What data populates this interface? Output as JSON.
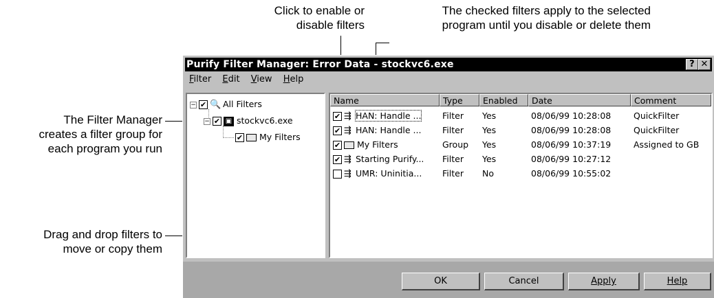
{
  "callouts": {
    "enable_line1": "Click to enable or",
    "enable_line2": "disable filters",
    "checked_line1": "The checked filters apply to the selected",
    "checked_line2": "program until you disable or delete them",
    "manager_line1": "The Filter Manager",
    "manager_line2": "creates a filter group for",
    "manager_line3": "each program you run",
    "drag_line1": "Drag and drop filters to",
    "drag_line2": "move or copy them"
  },
  "window": {
    "title": "Purify Filter Manager: Error Data - stockvc6.exe",
    "help_button": "?",
    "close_button": "✕"
  },
  "menu": [
    {
      "key": "F",
      "rest": "ilter"
    },
    {
      "key": "E",
      "rest": "dit"
    },
    {
      "key": "V",
      "rest": "iew"
    },
    {
      "key": "H",
      "rest": "elp"
    }
  ],
  "tree": {
    "root": "All Filters",
    "program": "stockvc6.exe",
    "group": "My Filters",
    "expander": "−"
  },
  "table": {
    "headers": [
      "Name",
      "Type",
      "Enabled",
      "Date",
      "Comment"
    ],
    "rows": [
      {
        "checked": "✔",
        "name": "HAN: Handle ...",
        "type": "Filter",
        "enabled": "Yes",
        "date": "08/06/99 10:28:08",
        "comment": "QuickFilter"
      },
      {
        "checked": "✔",
        "name": "HAN: Handle ...",
        "type": "Filter",
        "enabled": "Yes",
        "date": "08/06/99 10:28:08",
        "comment": "QuickFilter"
      },
      {
        "checked": "✔",
        "name": "My Filters",
        "type": "Group",
        "enabled": "Yes",
        "date": "08/06/99 10:37:19",
        "comment": "Assigned to GB"
      },
      {
        "checked": "✔",
        "name": "Starting Purify...",
        "type": "Filter",
        "enabled": "Yes",
        "date": "08/06/99 10:27:12",
        "comment": ""
      },
      {
        "checked": "",
        "name": "UMR: Uninitia...",
        "type": "Filter",
        "enabled": "No",
        "date": "08/06/99 10:55:02",
        "comment": ""
      }
    ]
  },
  "buttons": {
    "ok": "OK",
    "cancel": "Cancel",
    "apply": "Apply",
    "help": "Help"
  }
}
